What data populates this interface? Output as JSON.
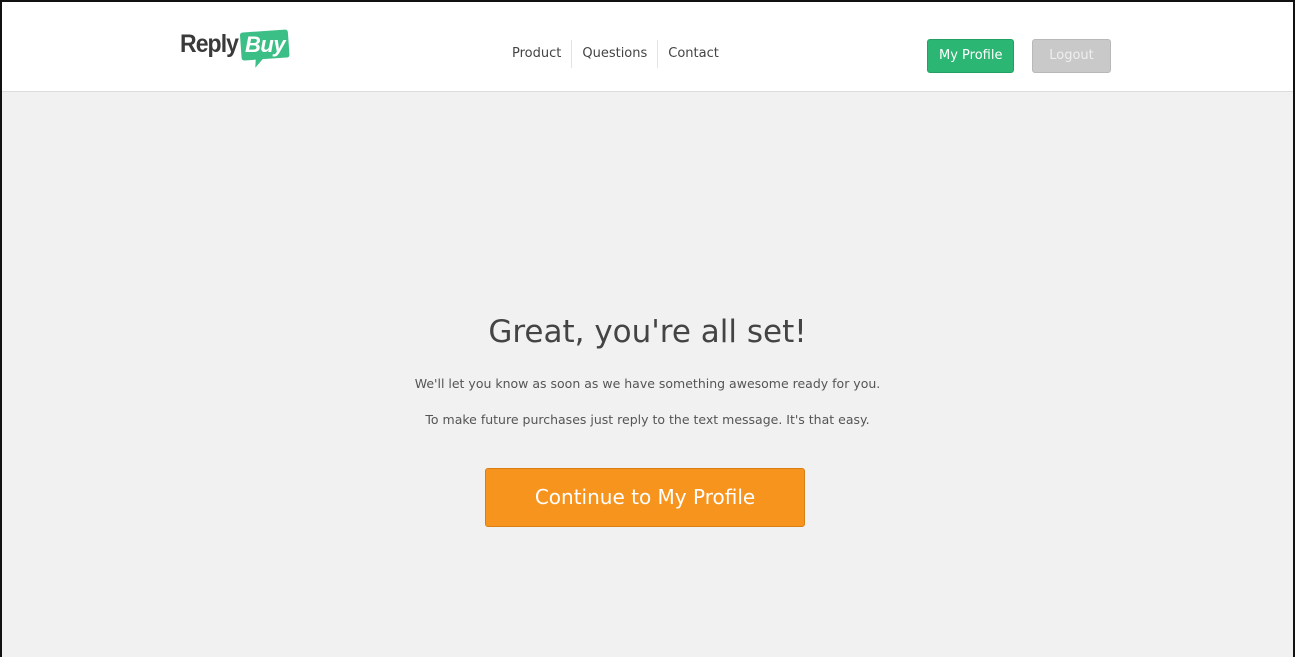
{
  "header": {
    "logo": {
      "word1": "Reply",
      "word2": "Buy",
      "word1_color": "#3a3a3a",
      "bubble_color": "#3cbf86"
    },
    "nav": [
      {
        "label": "Product"
      },
      {
        "label": "Questions"
      },
      {
        "label": "Contact"
      }
    ],
    "profile_button": "My Profile",
    "logout_button": "Logout"
  },
  "main": {
    "title": "Great, you're all set!",
    "message_1": "We'll let you know as soon as we have something awesome ready for you.",
    "message_2": "To make future purchases just reply to the text message. It's that easy.",
    "cta_button": "Continue to My Profile"
  },
  "colors": {
    "accent_green": "#2bb673",
    "cta_orange": "#f7941e",
    "background": "#f1f1f1",
    "logout_gray": "#c9c9c9"
  }
}
